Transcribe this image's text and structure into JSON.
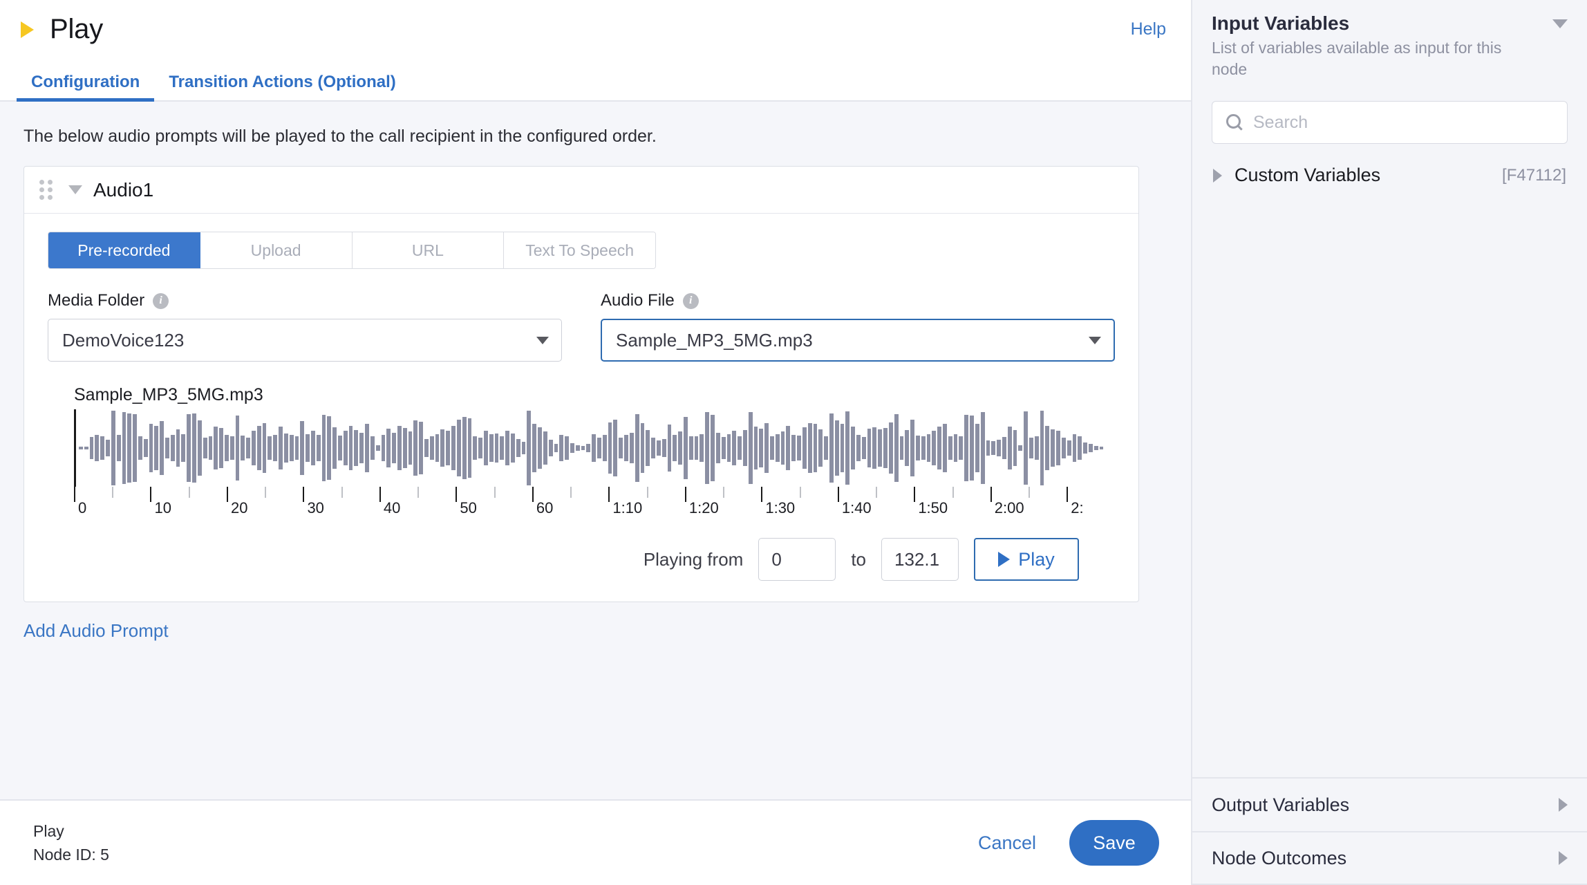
{
  "header": {
    "title": "Play",
    "node_icon": "play-triangle-icon",
    "help_label": "Help",
    "accent_color": "#2f6fc4",
    "node_icon_color": "#f6c722"
  },
  "tabs": [
    {
      "label": "Configuration",
      "active": true
    },
    {
      "label": "Transition Actions (Optional)",
      "active": false
    }
  ],
  "main": {
    "intro_text": "The below audio prompts will be played to the call recipient in the configured order.",
    "add_prompt_label": "Add Audio Prompt"
  },
  "prompt_card": {
    "name": "Audio1",
    "source_tabs": [
      {
        "label": "Pre-recorded",
        "active": true
      },
      {
        "label": "Upload",
        "active": false
      },
      {
        "label": "URL",
        "active": false
      },
      {
        "label": "Text To Speech",
        "active": false
      }
    ],
    "media_folder": {
      "label": "Media Folder",
      "value": "DemoVoice123"
    },
    "audio_file": {
      "label": "Audio File",
      "value": "Sample_MP3_5MG.mp3",
      "focused": true
    },
    "waveform": {
      "filename": "Sample_MP3_5MG.mp3",
      "bar_color": "#8b8fa3",
      "tick_labels": [
        "0",
        "10",
        "20",
        "30",
        "40",
        "50",
        "60",
        "1:10",
        "1:20",
        "1:30",
        "1:40",
        "1:50",
        "2:00",
        "2:"
      ],
      "amplitudes": [
        4,
        3,
        28,
        34,
        30,
        22,
        96,
        34,
        92,
        90,
        88,
        30,
        24,
        62,
        58,
        70,
        26,
        34,
        48,
        36,
        88,
        90,
        72,
        26,
        30,
        56,
        52,
        34,
        30,
        84,
        32,
        26,
        44,
        58,
        64,
        30,
        34,
        56,
        38,
        34,
        30,
        70,
        36,
        44,
        34,
        86,
        82,
        54,
        32,
        44,
        58,
        46,
        40,
        62,
        30,
        8,
        34,
        50,
        40,
        58,
        52,
        42,
        72,
        68,
        24,
        30,
        36,
        48,
        44,
        58,
        74,
        80,
        76,
        30,
        26,
        44,
        36,
        38,
        30,
        44,
        38,
        24,
        16,
        96,
        62,
        54,
        42,
        22,
        10,
        34,
        30,
        12,
        8,
        6,
        10,
        36,
        26,
        34,
        66,
        74,
        26,
        34,
        40,
        88,
        64,
        46,
        26,
        20,
        24,
        60,
        34,
        42,
        80,
        30,
        30,
        36,
        92,
        86,
        40,
        28,
        36,
        44,
        30,
        46,
        92,
        56,
        50,
        64,
        30,
        36,
        42,
        58,
        34,
        32,
        54,
        64,
        62,
        48,
        30,
        90,
        72,
        62,
        94,
        56,
        34,
        28,
        50,
        54,
        48,
        52,
        66,
        88,
        30,
        46,
        74,
        32,
        30,
        36,
        44,
        56,
        62,
        30,
        36,
        30,
        86,
        84,
        62,
        92,
        20,
        18,
        22,
        28,
        56,
        46,
        8,
        94,
        26,
        30,
        96,
        58,
        48,
        44,
        26,
        20,
        36,
        30,
        14,
        10,
        6,
        4
      ]
    },
    "playback": {
      "playing_from_label": "Playing from",
      "start_value": "0",
      "to_label": "to",
      "end_value": "132.1",
      "play_label": "Play"
    }
  },
  "bottom_bar": {
    "node_name": "Play",
    "node_id_label": "Node ID: 5",
    "cancel_label": "Cancel",
    "save_label": "Save"
  },
  "right_panel": {
    "title": "Input Variables",
    "subtitle": "List of variables available as input for this node",
    "search_placeholder": "Search",
    "variable_group": {
      "name": "Custom Variables",
      "code": "[F47112]"
    },
    "accordions": [
      {
        "label": "Output Variables"
      },
      {
        "label": "Node Outcomes"
      }
    ]
  }
}
